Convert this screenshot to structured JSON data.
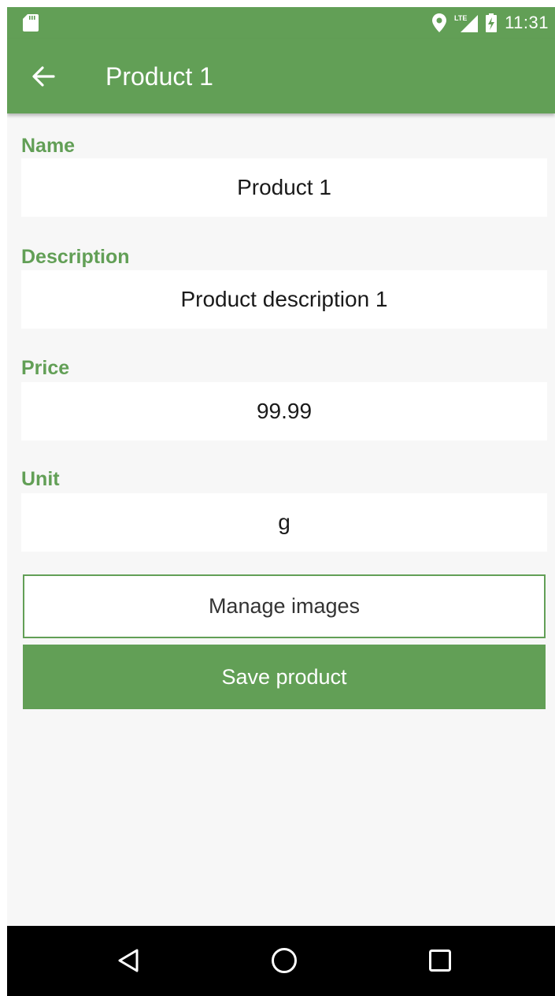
{
  "status_bar": {
    "time": "11:31",
    "network_label": "LTE",
    "icons": [
      "sd-card-icon",
      "location-icon",
      "signal-icon",
      "battery-charging-icon"
    ]
  },
  "app_bar": {
    "title": "Product 1",
    "back_icon": "arrow-left-icon"
  },
  "form": {
    "name": {
      "label": "Name",
      "value": "Product 1"
    },
    "description": {
      "label": "Description",
      "value": "Product description 1"
    },
    "price": {
      "label": "Price",
      "value": "99.99"
    },
    "unit": {
      "label": "Unit",
      "value": "g"
    }
  },
  "actions": {
    "manage_images": "Manage images",
    "save_product": "Save product"
  },
  "nav_bar": {
    "icons": [
      "back-triangle-icon",
      "home-circle-icon",
      "recents-square-icon"
    ]
  },
  "colors": {
    "primary": "#629f56",
    "background": "#f7f7f7",
    "nav_bar": "#000000"
  }
}
